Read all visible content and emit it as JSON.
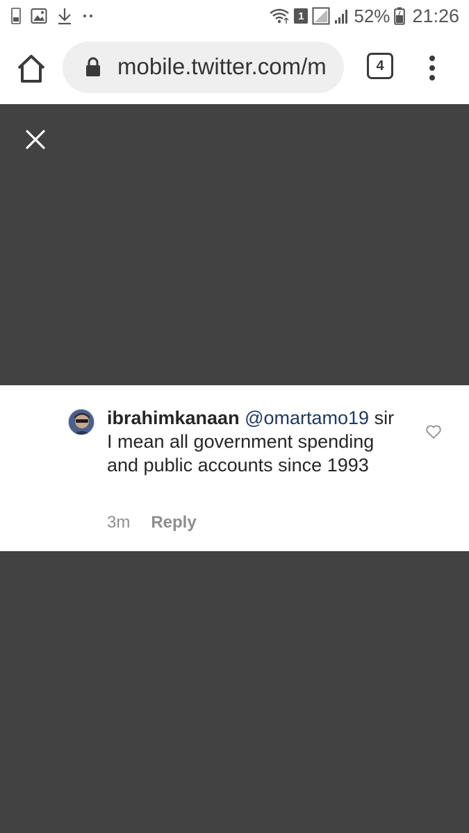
{
  "status_bar": {
    "icons_left": [
      "sim-card-icon",
      "image-icon",
      "download-icon",
      "more-dots-icon"
    ],
    "icons_right": [
      "wifi-icon",
      "sim-badge-icon",
      "no-signal-icon",
      "signal-icon",
      "battery-icon"
    ],
    "sim_badge": "1",
    "battery": "52%",
    "time": "21:26"
  },
  "browser": {
    "url": "mobile.twitter.com/m",
    "tab_count": "4"
  },
  "comment": {
    "username": "ibrahimkanaan",
    "mention": "@omartamo19",
    "text": "sir I mean all government spending and public accounts since 1993",
    "time": "3m",
    "reply_label": "Reply"
  },
  "colors": {
    "viewer_bg": "#424242",
    "mention": "#1f3a66",
    "meta": "#8e8e8e"
  }
}
